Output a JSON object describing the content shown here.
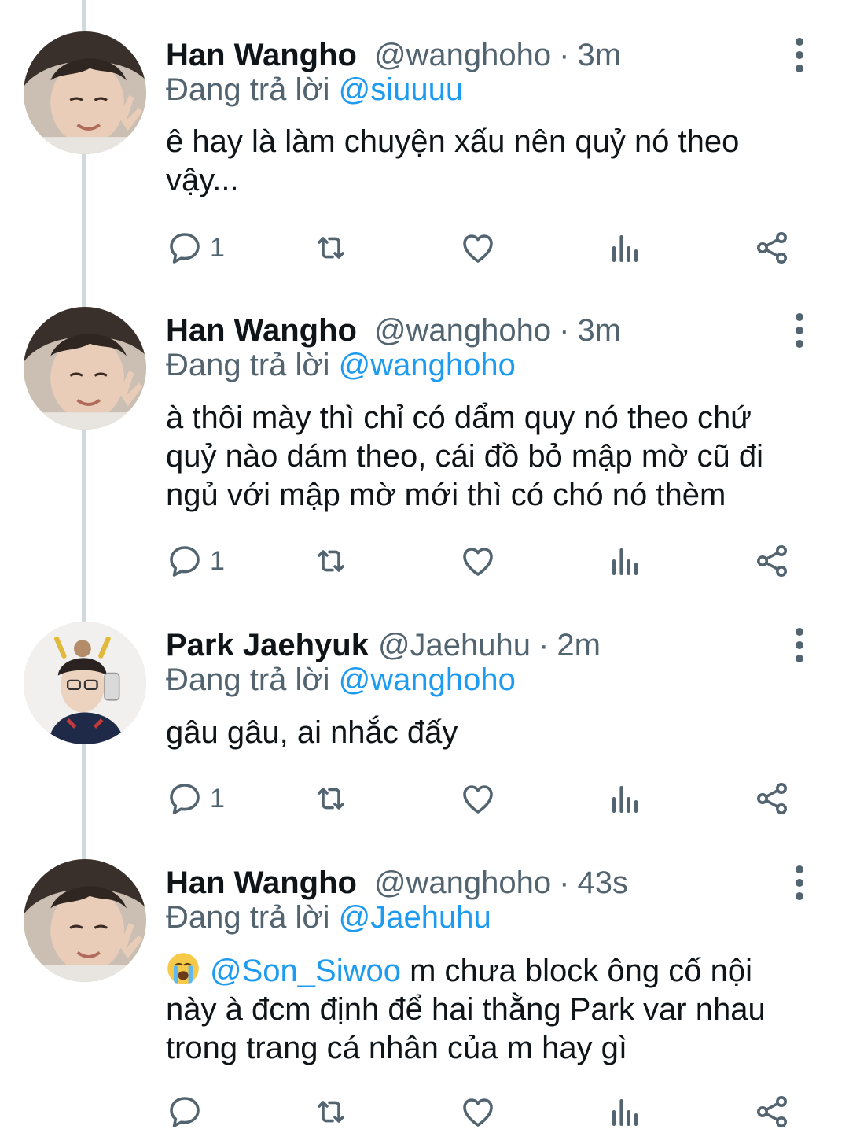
{
  "reply_prefix": "Đang trả lời",
  "tweets": [
    {
      "name": "Han Wangho",
      "handle": "@wanghoho",
      "dot": "·",
      "time": "3m",
      "reply_to": "@siuuuu",
      "lines": [
        "ê hay là làm chuyện xấu nên quỷ nó theo",
        "vậy..."
      ],
      "reply_count": "1"
    },
    {
      "name": "Han Wangho",
      "handle": "@wanghoho",
      "dot": "·",
      "time": "3m",
      "reply_to": "@wanghoho",
      "lines": [
        "à thôi mày thì chỉ có dẩm quy nó theo chứ",
        "quỷ nào dám theo, cái đồ bỏ mập mờ cũ đi",
        "ngủ với mập mờ mới thì có chó nó thèm"
      ],
      "reply_count": "1"
    },
    {
      "name": "Park Jaehyuk",
      "handle": "@Jaehuhu",
      "dot": "·",
      "time": "2m",
      "reply_to": "@wanghoho",
      "lines": [
        "gâu gâu, ai nhắc đấy"
      ],
      "reply_count": "1"
    },
    {
      "name": "Han Wangho",
      "handle": "@wanghoho",
      "dot": "·",
      "time": "43s",
      "reply_to": "@Jaehuhu",
      "mention_in_body": "@Son_Siwoo",
      "first_line_rest": " m chưa block ông cố nội",
      "lines": [
        "này à đcm định để hai thằng Park var nhau",
        "trong trang cá nhân của m hay gì"
      ],
      "reply_count": ""
    }
  ],
  "icons": [
    "reply-icon",
    "retweet-icon",
    "like-icon",
    "views-icon",
    "share-icon",
    "more-icon",
    "loudly-crying-emoji"
  ],
  "colors": {
    "accent": "#1d9bf0",
    "secondary_text": "#536471",
    "thread_line": "#cfd9de"
  }
}
